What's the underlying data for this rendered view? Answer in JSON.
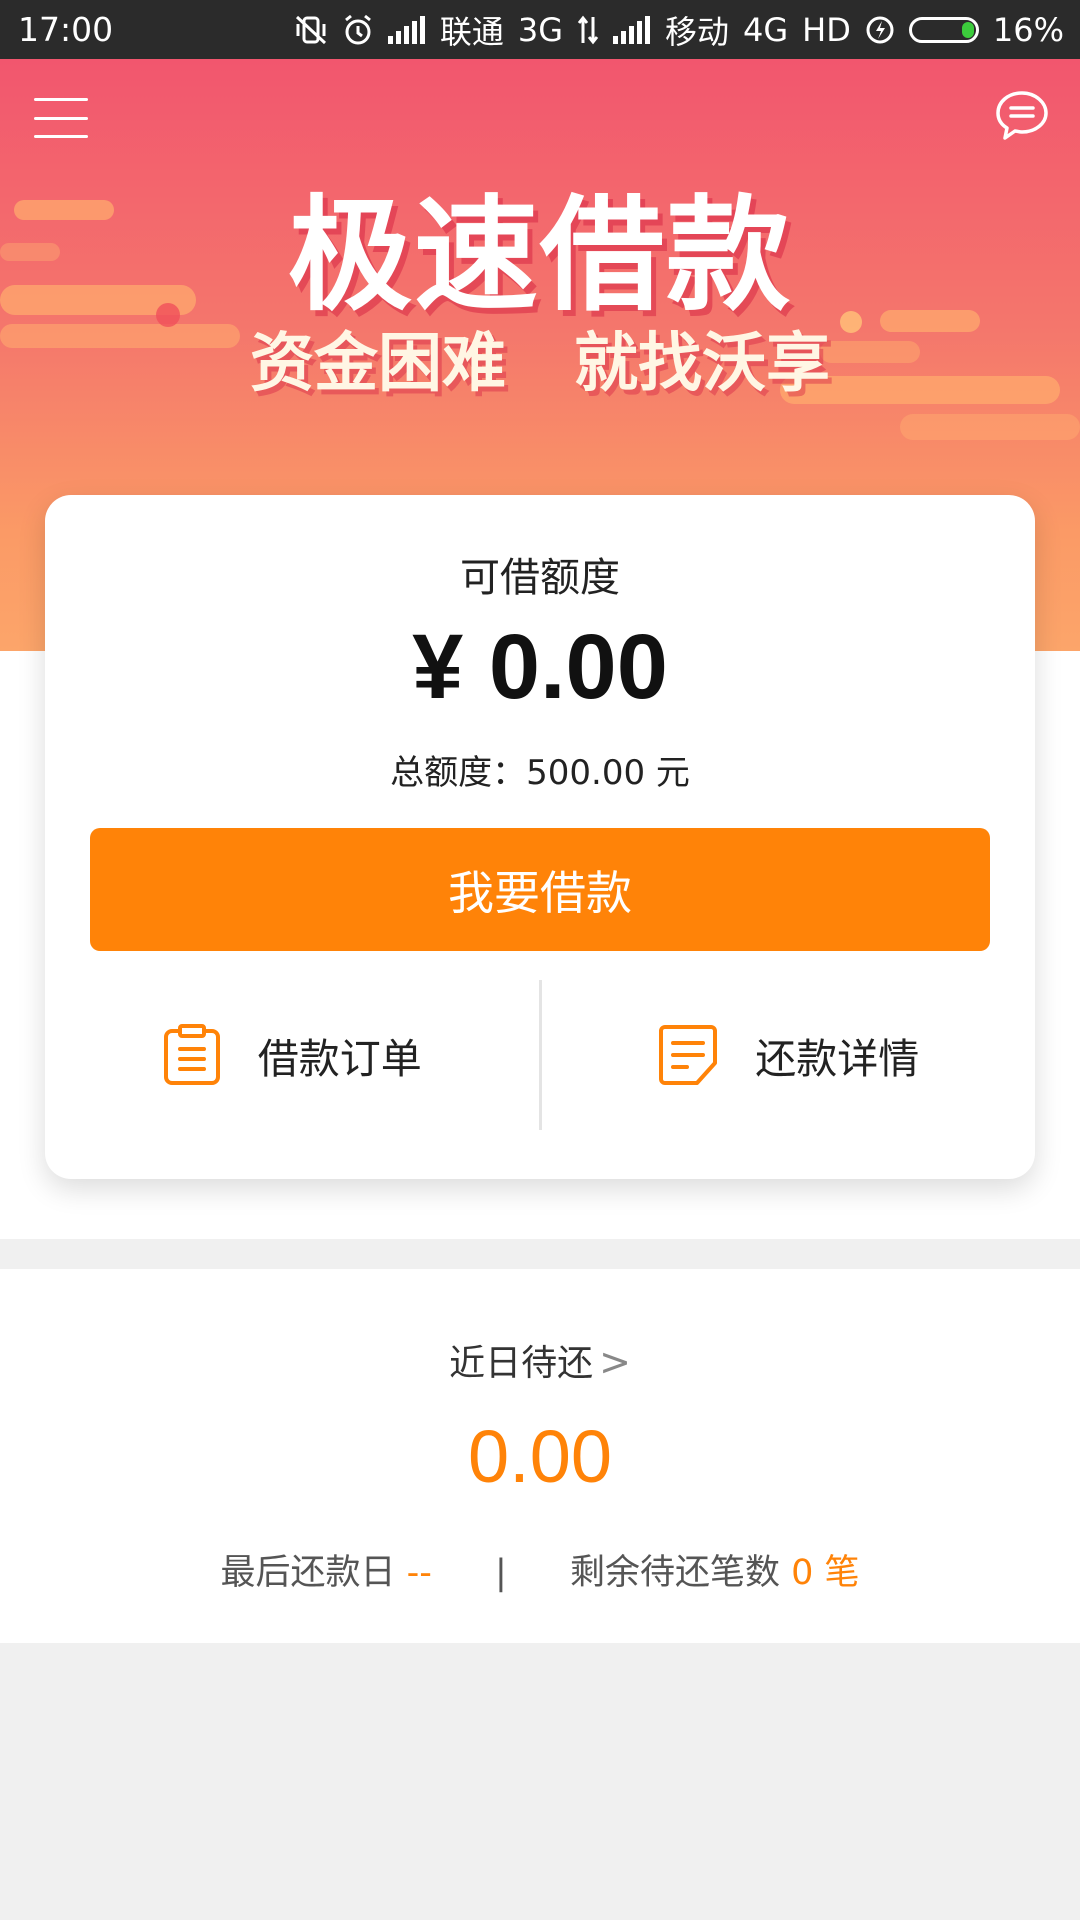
{
  "status_bar": {
    "time": "17:00",
    "carrier1": "联通",
    "net1": "3G",
    "carrier2": "移动",
    "net2": "4G",
    "hd": "HD",
    "battery": "16%"
  },
  "hero": {
    "title": "极速借款",
    "subtitle_left": "资金困难",
    "subtitle_right": "就找沃享"
  },
  "card": {
    "label": "可借额度",
    "amount": "¥ 0.00",
    "total_label": "总额度：",
    "total_value": "500.00 元",
    "button_label": "我要借款",
    "actions": [
      {
        "label": "借款订单",
        "icon": "clipboard-icon"
      },
      {
        "label": "还款详情",
        "icon": "document-icon"
      }
    ]
  },
  "repayment": {
    "title": "近日待还",
    "chevron": ">",
    "amount": "0.00",
    "last_date_label": "最后还款日",
    "last_date_value": "--",
    "separator": "|",
    "remaining_label": "剩余待还笔数",
    "remaining_value": "0 笔"
  },
  "colors": {
    "accent": "#ff8308",
    "hero_top": "#f2566e",
    "hero_bottom": "#fca56a"
  }
}
